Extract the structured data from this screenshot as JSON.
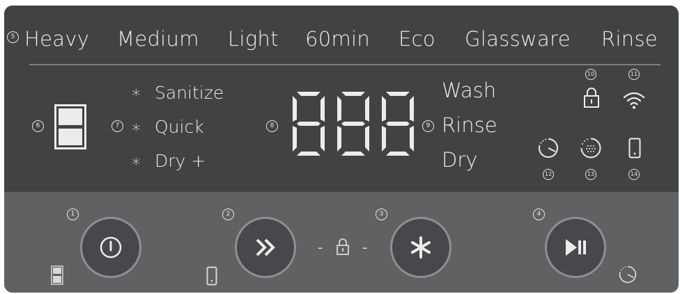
{
  "programs": {
    "badge": "5",
    "items": [
      "Heavy",
      "Medium",
      "Light",
      "60min",
      "Eco",
      "Glassware",
      "Rinse"
    ]
  },
  "indicators": {
    "half_load_badge": "6",
    "options_badge": "7",
    "display_badge": "8",
    "phase_badge": "9",
    "options": [
      {
        "star": "*",
        "label": "Sanitize"
      },
      {
        "star": "*",
        "label": "Quick"
      },
      {
        "star": "*",
        "label": "Dry +"
      }
    ],
    "display_value": "888",
    "phases": [
      "Wash",
      "Rinse",
      "Dry"
    ]
  },
  "status_icons": [
    {
      "badge": "10",
      "icon": "lock-icon"
    },
    {
      "badge": "11",
      "icon": "wifi-icon"
    },
    {
      "badge": "12",
      "icon": "delay-timer-icon"
    },
    {
      "badge": "13",
      "icon": "rinse-aid-icon"
    },
    {
      "badge": "14",
      "icon": "mobile-icon"
    }
  ],
  "buttons": [
    {
      "badge": "1",
      "icon": "power-icon",
      "sub_icon": "half-load-icon"
    },
    {
      "badge": "2",
      "icon": "fast-forward-icon",
      "sub_icon": "mobile-icon"
    },
    {
      "badge": "3",
      "icon": "asterisk-icon"
    },
    {
      "badge": "4",
      "icon": "play-pause-icon",
      "sub_icon": "delay-timer-icon"
    }
  ],
  "child_lock": {
    "left_dash": "-",
    "right_dash": "-",
    "icon": "lock-icon"
  },
  "colors": {
    "upper_panel": "#414244",
    "lower_panel": "#5f6163",
    "text": "#ececec",
    "button_fill": "#47484b",
    "button_ring": "#8e9093"
  }
}
